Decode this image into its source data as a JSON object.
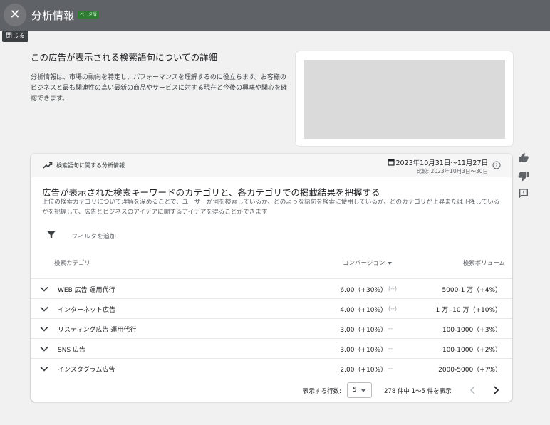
{
  "topbar": {
    "close_glyph": "✕",
    "title": "分析情報",
    "beta_badge": "ベータ版",
    "close_tooltip": "閉じる"
  },
  "detail": {
    "title": "この広告が表示される検索語句についての詳細",
    "description": "分析情報は、市場の動向を特定し、パフォーマンスを理解するのに役立ちます。お客様のビジネスと最も関連性の高い最新の商品やサービスに対する現在と今後の興味や関心を確認できます。"
  },
  "card": {
    "header_label": "検索語句に関する分析情報",
    "date_range": "2023年10月31日～11月27日",
    "compare_range": "比較: 2023年10月3日～30日",
    "headline": "広告が表示された検索キーワードのカテゴリと、各カテゴリでの掲載結果を把握する",
    "subtext": "上位の検索カテゴリについて理解を深めることで、ユーザーが何を検索しているか、どのような語句を検索に使用しているか、どのカテゴリが上昇または下降しているかを把握して、広告とビジネスのアイデアに関するアイデアを得ることができます",
    "filter_placeholder": "フィルタを追加"
  },
  "table": {
    "headers": {
      "category": "検索カテゴリ",
      "conversions": "コンバージョン",
      "volume": "検索ボリューム"
    },
    "rows": [
      {
        "category": "WEB 広告 運用代行",
        "conversions": "6.00（+30%）",
        "conversions_extra": "(--)",
        "volume": "5000-1 万（+4%）"
      },
      {
        "category": "インターネット広告",
        "conversions": "4.00（+10%）",
        "conversions_extra": "(--)",
        "volume": "1 万 -10 万（+10%）"
      },
      {
        "category": "リスティング広告 運用代行",
        "conversions": "3.00（+10%）",
        "conversions_extra": "--",
        "volume": "100-1000（+3%）"
      },
      {
        "category": "SNS 広告",
        "conversions": "3.00（+10%）",
        "conversions_extra": "--",
        "volume": "100-1000（+2%）"
      },
      {
        "category": "インスタグラム広告",
        "conversions": "2.00（+10%）",
        "conversions_extra": "--",
        "volume": "2000-5000（+7%）"
      }
    ]
  },
  "pagination": {
    "rows_label": "表示する行数:",
    "rows_value": "5",
    "page_info": "278 件中 1～5 件を表示"
  },
  "icons": {
    "side": [
      "thumb-up-icon",
      "thumb-down-icon",
      "feedback-icon"
    ]
  },
  "colors": {
    "topbar": "#5f6368",
    "beta_badge": "#2e7d32",
    "background": "#f1f1f1"
  }
}
